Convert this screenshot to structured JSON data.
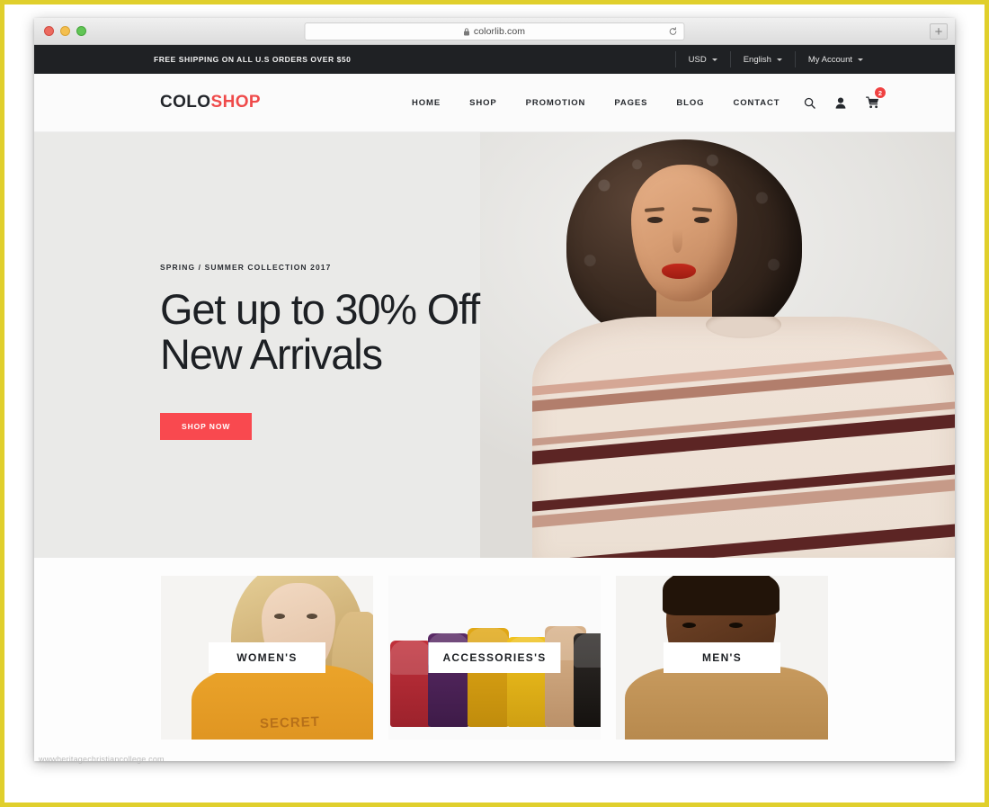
{
  "browser": {
    "url": "colorlib.com",
    "lock_icon": "lock-icon",
    "reload_icon": "reload-icon",
    "new_tab_label": "+",
    "traffic_lights": [
      "close",
      "minimize",
      "maximize"
    ]
  },
  "topbar": {
    "shipping_note": "FREE SHIPPING ON ALL U.S ORDERS OVER $50",
    "items": [
      {
        "label": "USD",
        "icon": "chevron-down-icon"
      },
      {
        "label": "English",
        "icon": "chevron-down-icon"
      },
      {
        "label": "My Account",
        "icon": "chevron-down-icon"
      }
    ],
    "background": "#1f2124"
  },
  "header": {
    "logo": {
      "part1": "COLO",
      "part2": "SHOP",
      "accent": "#ef4a4a"
    },
    "nav": [
      {
        "label": "HOME"
      },
      {
        "label": "SHOP"
      },
      {
        "label": "PROMOTION"
      },
      {
        "label": "PAGES"
      },
      {
        "label": "BLOG"
      },
      {
        "label": "CONTACT"
      }
    ],
    "icons": [
      {
        "name": "search-icon"
      },
      {
        "name": "user-icon"
      },
      {
        "name": "cart-icon"
      }
    ],
    "cart_count": "2",
    "cart_badge_color": "#ef4141"
  },
  "hero": {
    "kicker": "SPRING / SUMMER COLLECTION 2017",
    "title_line1": "Get up to 30% Off",
    "title_line2": "New Arrivals",
    "cta": "SHOP NOW",
    "cta_color": "#f9494f",
    "background": "#eaeae8",
    "image_alt": "woman-in-striped-sweater"
  },
  "categories": [
    {
      "label": "WOMEN'S",
      "image_alt": "blonde-woman-in-yellow-tshirt"
    },
    {
      "label": "ACCESSORIES'S",
      "image_alt": "row-of-colored-handbags"
    },
    {
      "label": "MEN'S",
      "image_alt": "man-in-tan-jacket"
    }
  ],
  "watermark": "wwwheritagechristiancollege.com"
}
